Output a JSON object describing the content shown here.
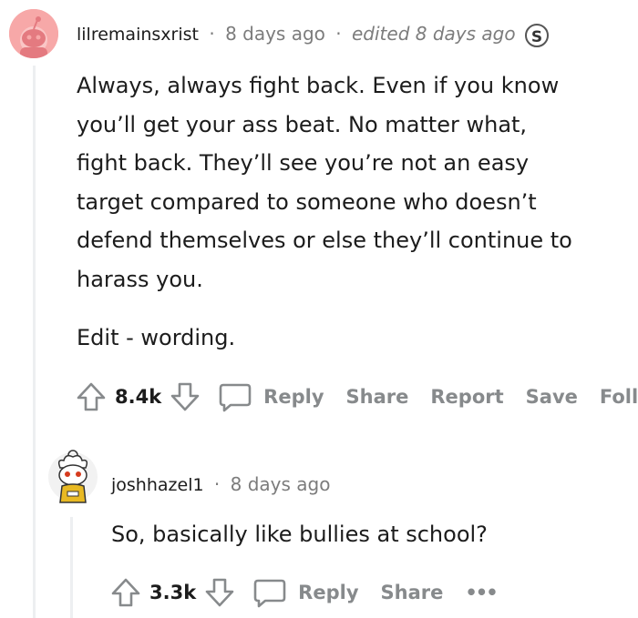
{
  "comment1": {
    "username": "lilremainsxrist",
    "separator": "·",
    "time": "8 days ago",
    "edited": "edited 8 days ago",
    "badge": "S",
    "body_lines": [
      "Always, always fight back. Even if you know",
      "you’ll get your ass beat. No matter what,",
      "fight back. They’ll see you’re not an easy",
      "target compared to someone who doesn’t",
      "defend themselves or else they’ll continue to",
      "harass you."
    ],
    "edit_note": "Edit - wording.",
    "votes": "8.4k",
    "actions": {
      "reply": "Reply",
      "share": "Share",
      "report": "Report",
      "save": "Save",
      "follow": "Follow"
    }
  },
  "comment2": {
    "username": "joshhazel1",
    "separator": "·",
    "time": "8 days ago",
    "body": "So, basically like bullies at school?",
    "votes": "3.3k",
    "actions": {
      "reply": "Reply",
      "share": "Share",
      "more": "•••"
    }
  },
  "colors": {
    "meta_gray": "#7c7c7c",
    "action_gray": "#878a8c",
    "thread_line": "#edeff1",
    "avatar_pink": "#f7a8a8"
  }
}
